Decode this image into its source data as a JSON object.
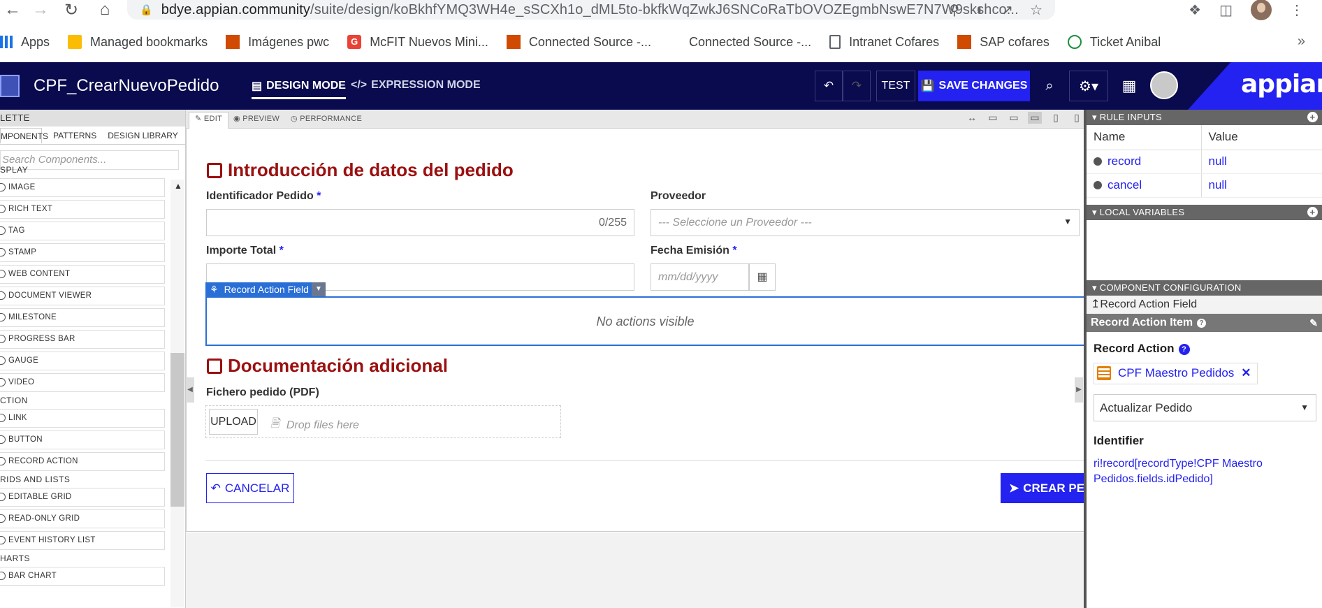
{
  "browser": {
    "url_domain": "bdye.appian.community",
    "url_path": "/suite/design/koBkhfYMQ3WH4e_sSCXh1o_dML5to-bkfkWqZwkJ6SNCoRaTbOVOZEgmbNswE7N7W9skshco...",
    "bookmarks": [
      {
        "icon": "apps-grid-icon",
        "label": "Apps"
      },
      {
        "icon": "folder-icon",
        "label": "Managed bookmarks"
      },
      {
        "icon": "pwc-icon",
        "label": "Imágenes pwc"
      },
      {
        "icon": "g-icon",
        "label": "McFIT Nuevos Mini..."
      },
      {
        "icon": "pwc-icon",
        "label": "Connected Source -..."
      },
      {
        "icon": "blank-icon",
        "label": "Connected Source -..."
      },
      {
        "icon": "doc-icon",
        "label": "Intranet Cofares"
      },
      {
        "icon": "pwc-icon",
        "label": "SAP cofares"
      },
      {
        "icon": "ticket-icon",
        "label": "Ticket Anibal"
      }
    ],
    "more": "»"
  },
  "header": {
    "app_name": "CPF_CrearNuevoPedido",
    "design_mode": "DESIGN MODE",
    "expression_mode": "EXPRESSION MODE",
    "test": "TEST",
    "save": "SAVE CHANGES",
    "brand": "appian"
  },
  "palette": {
    "title": "LETTE",
    "tabs": [
      "MPONENTS",
      "PATTERNS",
      "DESIGN LIBRARY"
    ],
    "search_placeholder": "Search Components...",
    "sections": [
      {
        "title": "SPLAY",
        "items": [
          "IMAGE",
          "RICH TEXT",
          "TAG",
          "STAMP",
          "WEB CONTENT",
          "DOCUMENT VIEWER",
          "MILESTONE",
          "PROGRESS BAR",
          "GAUGE",
          "VIDEO"
        ]
      },
      {
        "title": "CTION",
        "items": [
          "LINK",
          "BUTTON",
          "RECORD ACTION"
        ]
      },
      {
        "title": "RIDS AND LISTS",
        "items": [
          "EDITABLE GRID",
          "READ-ONLY GRID",
          "EVENT HISTORY LIST"
        ]
      },
      {
        "title": "HARTS",
        "items": [
          "BAR CHART"
        ]
      }
    ]
  },
  "editor": {
    "tabs": [
      "EDIT",
      "PREVIEW",
      "PERFORMANCE"
    ],
    "section1_title": "Introducción de datos del pedido",
    "id_label": "Identificador Pedido",
    "id_counter": "0/255",
    "provider_label": "Proveedor",
    "provider_placeholder": "--- Seleccione un Proveedor ---",
    "total_label": "Importe Total",
    "date_label": "Fecha Emisión",
    "date_placeholder": "mm/dd/yyyy",
    "required_mark": "*",
    "raf_badge": "Record Action Field",
    "raf_empty": "No actions visible",
    "section2_title": "Documentación adicional",
    "file_label": "Fichero pedido (PDF)",
    "upload": "UPLOAD",
    "drop": "Drop files here",
    "cancel": "CANCELAR",
    "create": "CREAR PEDIDO"
  },
  "rpanel": {
    "rule_inputs": "RULE INPUTS",
    "col_name": "Name",
    "col_value": "Value",
    "inputs": [
      {
        "name": "record",
        "value": "null"
      },
      {
        "name": "cancel",
        "value": "null"
      }
    ],
    "local_vars": "LOCAL VARIABLES",
    "component_config": "COMPONENT CONFIGURATION",
    "cc_parent": "Record Action Field",
    "cc_item": "Record Action Item",
    "record_action_label": "Record Action",
    "record_type": "CPF Maestro Pedidos",
    "action": "Actualizar Pedido",
    "identifier_label": "Identifier",
    "identifier_expr": "ri!record[recordType!CPF Maestro Pedidos.fields.idPedido]"
  }
}
